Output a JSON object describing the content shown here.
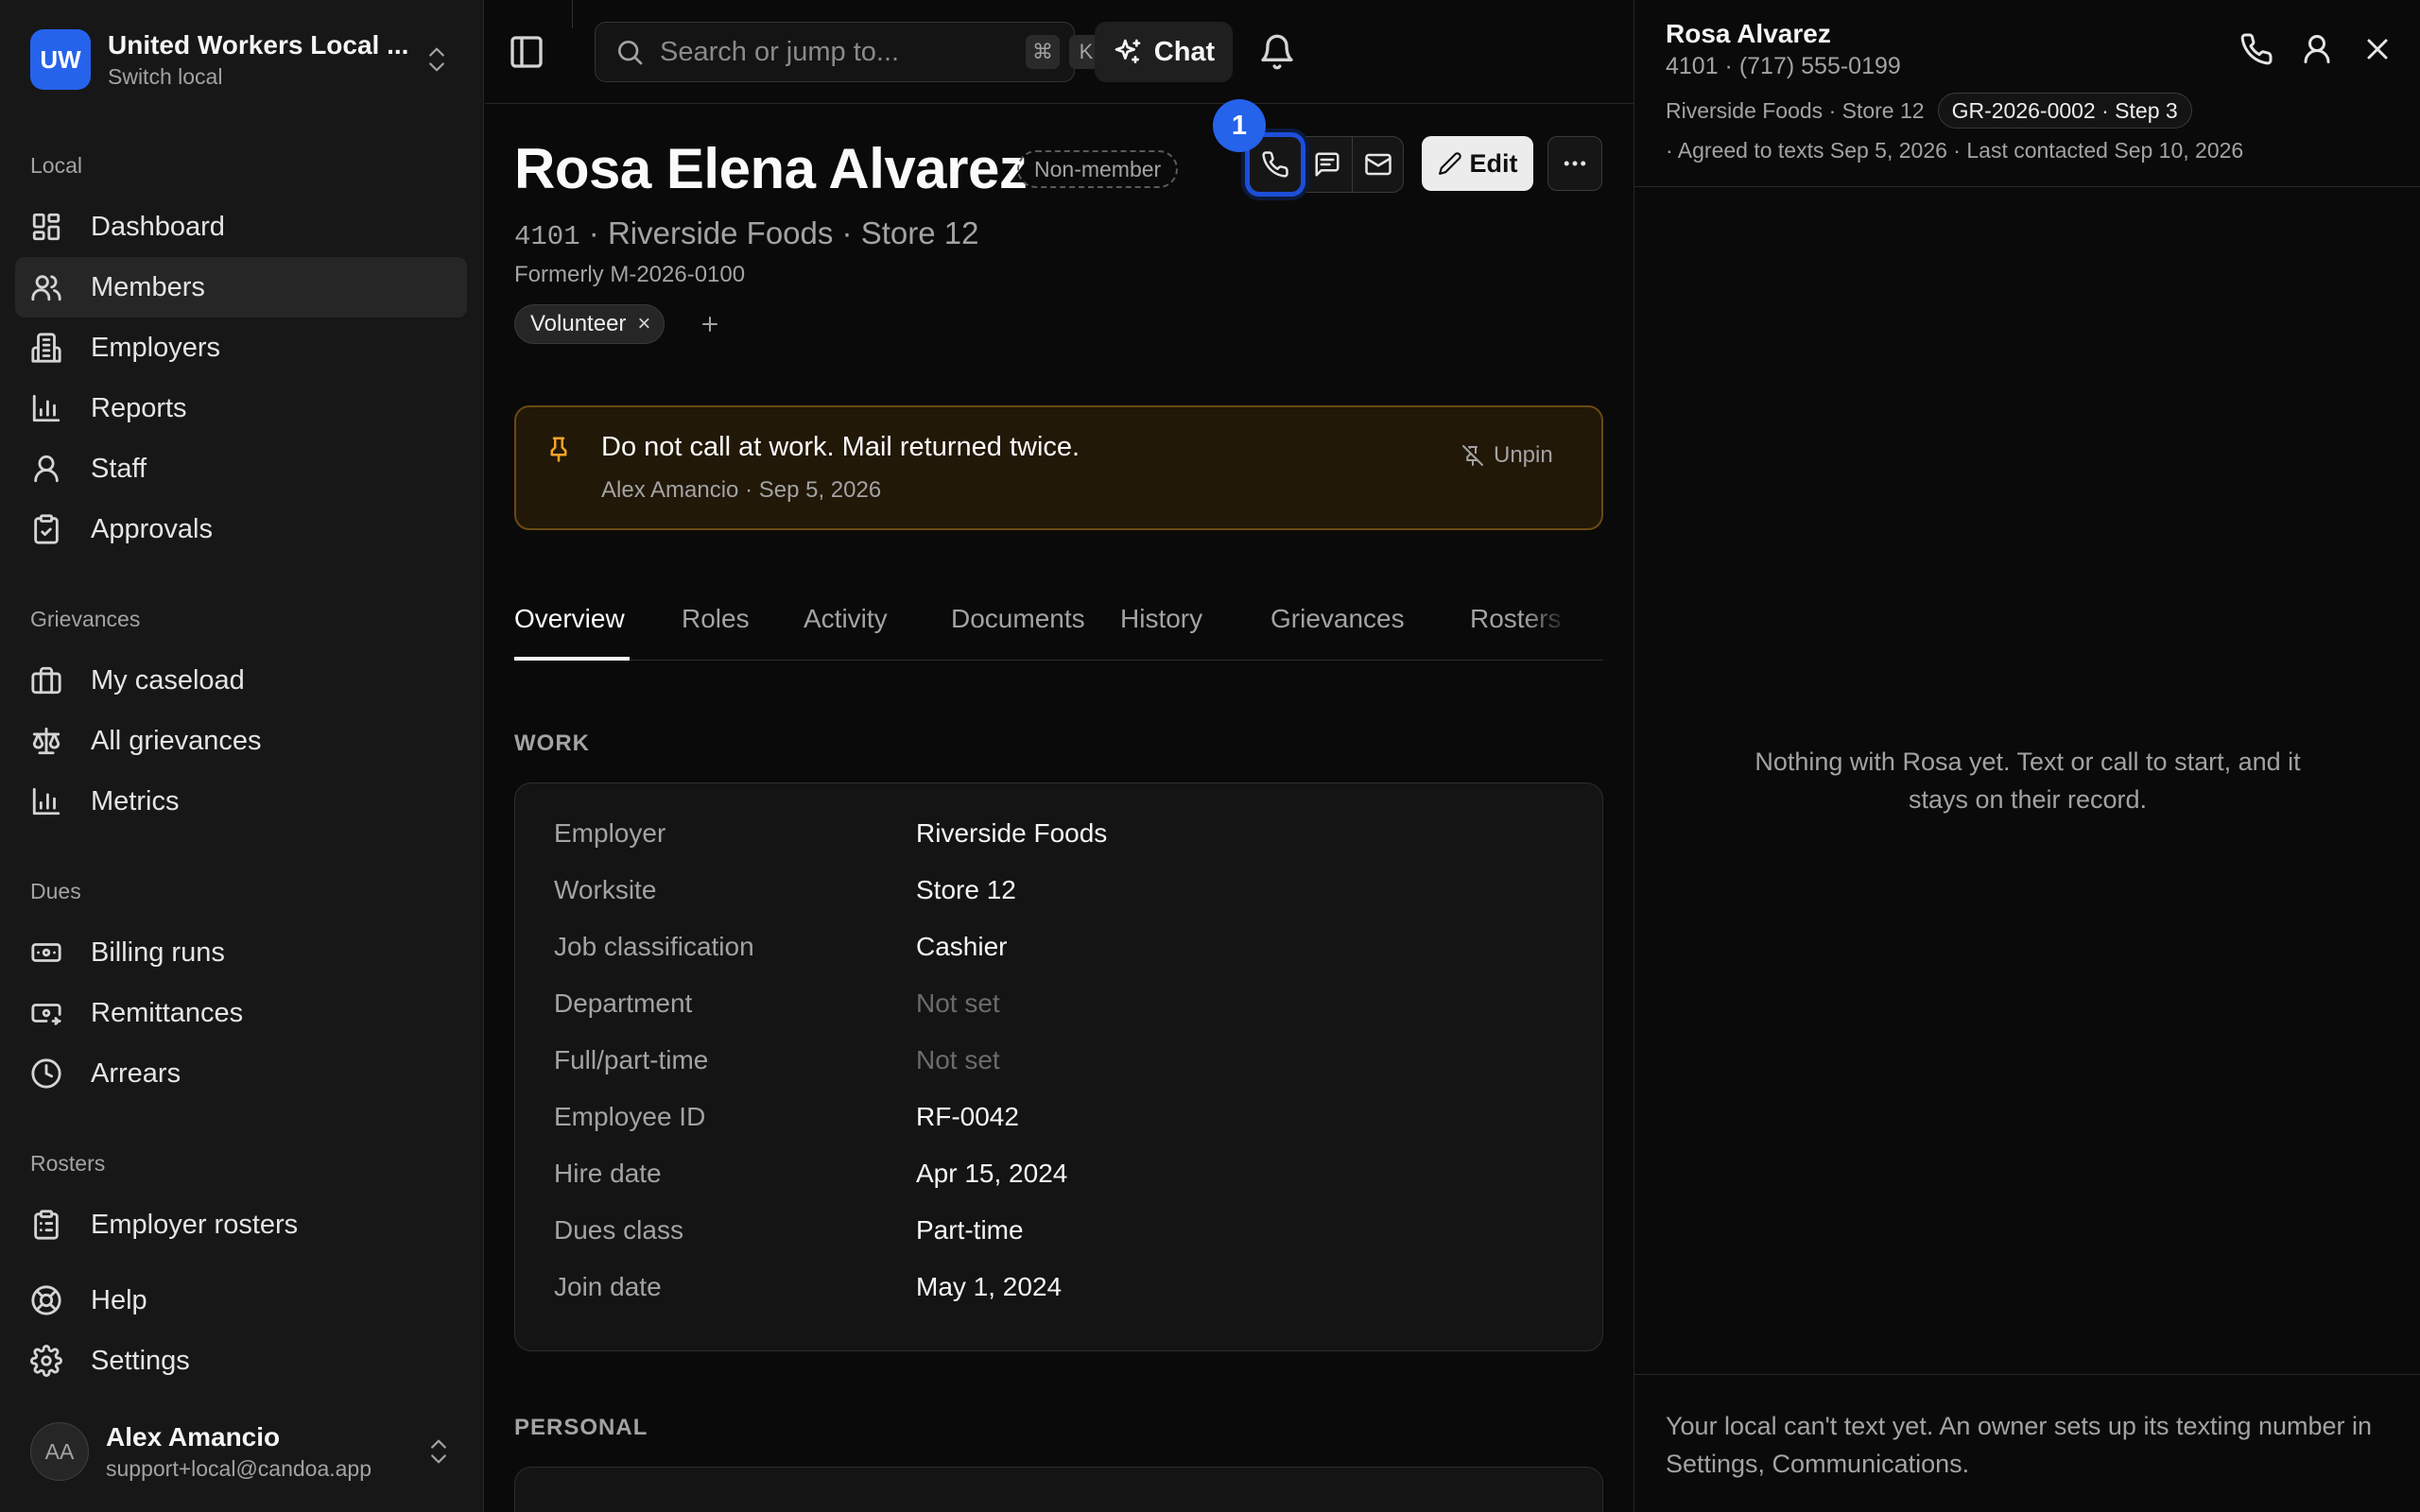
{
  "local": {
    "badge": "UW",
    "name": "United Workers Local ...",
    "sub": "Switch local"
  },
  "nav": {
    "local_label": "Local",
    "local_items": [
      {
        "label": "Dashboard",
        "icon": "dashboard-icon"
      },
      {
        "label": "Members",
        "icon": "users-icon",
        "active": true
      },
      {
        "label": "Employers",
        "icon": "building-icon"
      },
      {
        "label": "Reports",
        "icon": "bar-chart-icon"
      },
      {
        "label": "Staff",
        "icon": "user-icon"
      },
      {
        "label": "Approvals",
        "icon": "clipboard-check-icon"
      }
    ],
    "grievances_label": "Grievances",
    "grievance_items": [
      {
        "label": "My caseload",
        "icon": "briefcase-icon"
      },
      {
        "label": "All grievances",
        "icon": "scale-icon"
      },
      {
        "label": "Metrics",
        "icon": "bar-chart-icon"
      }
    ],
    "dues_label": "Dues",
    "dues_items": [
      {
        "label": "Billing runs",
        "icon": "banknote-icon"
      },
      {
        "label": "Remittances",
        "icon": "banknote-arrow-icon"
      },
      {
        "label": "Arrears",
        "icon": "clock-icon"
      }
    ],
    "rosters_label": "Rosters",
    "roster_items": [
      {
        "label": "Employer rosters",
        "icon": "clipboard-list-icon"
      }
    ],
    "bottom_items": [
      {
        "label": "Help",
        "icon": "life-buoy-icon"
      },
      {
        "label": "Settings",
        "icon": "gear-icon"
      }
    ]
  },
  "user": {
    "initials": "AA",
    "name": "Alex Amancio",
    "email": "support+local@candoa.app"
  },
  "topbar": {
    "search_placeholder": "Search or jump to...",
    "kbd_cmd": "⌘",
    "kbd_k": "K",
    "chat_label": "Chat"
  },
  "member": {
    "name": "Rosa Elena Alvarez",
    "status": "Non-member",
    "step_badge": "1",
    "edit_label": "Edit",
    "number": "4101",
    "sub_rest": " · Riverside Foods · Store 12",
    "formerly": "Formerly M-2026-0100",
    "tag": "Volunteer",
    "tag_remove": "×"
  },
  "pinned": {
    "text": "Do not call at work. Mail returned twice.",
    "meta": "Alex Amancio · Sep 5, 2026",
    "unpin_label": "Unpin"
  },
  "tabs": [
    "Overview",
    "Roles",
    "Activity",
    "Documents",
    "History",
    "Grievances",
    "Rosters"
  ],
  "work": {
    "label": "WORK",
    "rows": [
      {
        "label": "Employer",
        "value": "Riverside Foods"
      },
      {
        "label": "Worksite",
        "value": "Store 12"
      },
      {
        "label": "Job classification",
        "value": "Cashier"
      },
      {
        "label": "Department",
        "value": "Not set",
        "muted": true
      },
      {
        "label": "Full/part-time",
        "value": "Not set",
        "muted": true
      },
      {
        "label": "Employee ID",
        "value": "RF-0042"
      },
      {
        "label": "Hire date",
        "value": "Apr 15, 2024"
      },
      {
        "label": "Dues class",
        "value": "Part-time"
      },
      {
        "label": "Join date",
        "value": "May 1, 2024"
      }
    ]
  },
  "personal": {
    "label": "PERSONAL"
  },
  "panel": {
    "name": "Rosa Alvarez",
    "phone": "4101 · (717) 555-0199",
    "meta": "Riverside Foods · Store 12",
    "grievance_chip": "GR-2026-0002 · Step 3",
    "meta2": "· Agreed to texts Sep 5, 2026  · Last contacted Sep 10, 2026",
    "empty": "Nothing with Rosa yet. Text or call to start, and it stays on their record.",
    "footer": "Your local can't text yet. An owner sets up its texting number in Settings, Communications."
  }
}
